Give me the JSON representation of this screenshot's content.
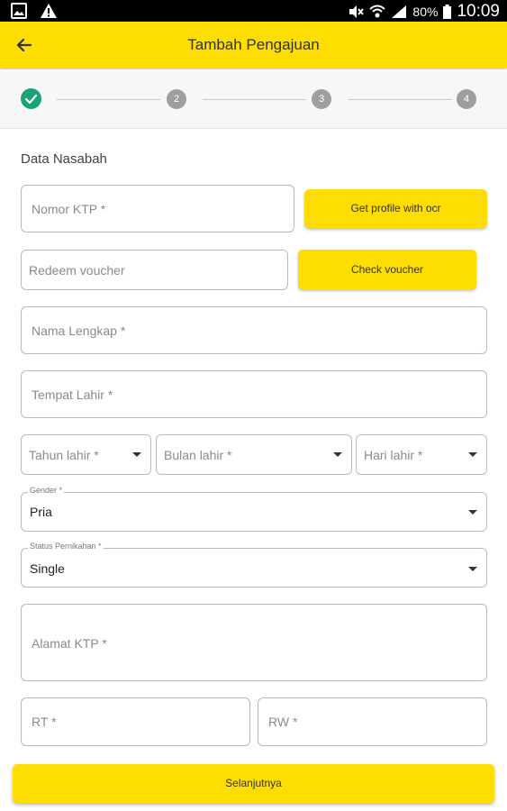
{
  "status_bar": {
    "time": "10:09",
    "battery": "80%",
    "icons": [
      "gallery-icon",
      "warning-icon",
      "mute-icon",
      "wifi-icon",
      "signal-icon",
      "battery-icon"
    ]
  },
  "appbar": {
    "title": "Tambah Pengajuan",
    "back_icon": "arrow-left-icon"
  },
  "stepper": {
    "steps": [
      "2",
      "3",
      "4"
    ],
    "done_icon": "check-icon"
  },
  "form": {
    "section_title": "Data Nasabah",
    "ktp_placeholder": "Nomor KTP *",
    "ocr_button": "Get profile with ocr",
    "voucher_placeholder": "Redeem voucher",
    "voucher_button": "Check voucher",
    "name_placeholder": "Nama Lengkap *",
    "birthplace_placeholder": "Tempat Lahir *",
    "year_placeholder": "Tahun lahir *",
    "month_placeholder": "Bulan lahir *",
    "day_placeholder": "Hari lahir *",
    "gender_label": "Gender *",
    "gender_value": "Pria",
    "marital_label": "Status Pernikahan *",
    "marital_value": "Single",
    "address_placeholder": "Alamat KTP *",
    "rt_placeholder": "RT *",
    "rw_placeholder": "RW *",
    "next_button": "Selanjutnya"
  },
  "colors": {
    "accent": "#fedd00",
    "success": "#1aa37a",
    "inactive_step": "#9e9e9e"
  }
}
